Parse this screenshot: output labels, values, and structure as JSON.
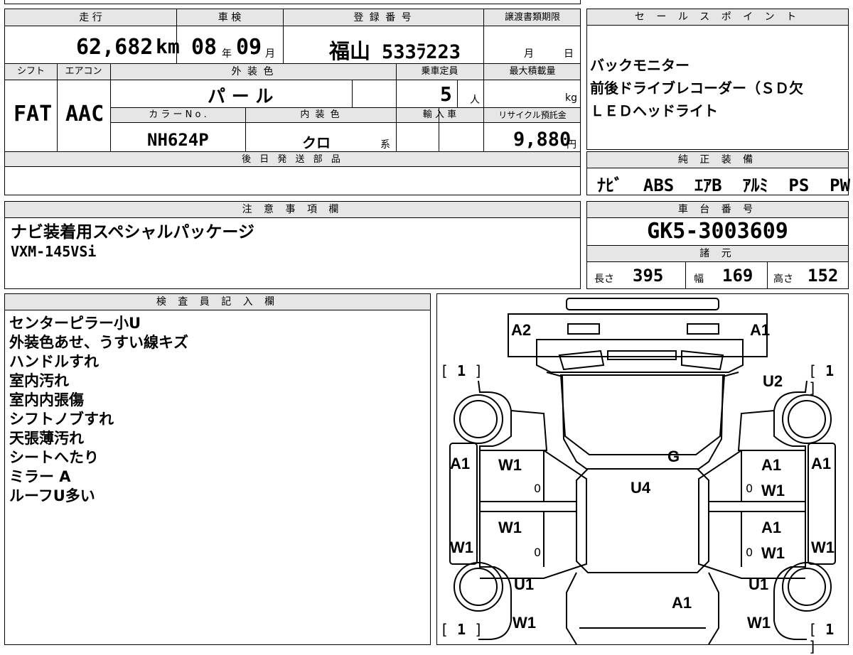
{
  "top": {
    "mileage_label": "走 行",
    "mileage": "62,682",
    "mileage_unit": "km",
    "inspection_label": "車 検",
    "inspection_year": "08",
    "inspection_year_unit": "年",
    "inspection_month": "09",
    "inspection_month_unit": "月",
    "registration_label": "登 録 番 号",
    "registration_place": "福山",
    "registration_number": "533ﾗ223",
    "deadline_label": "譲渡書類期限",
    "deadline_month_unit": "月",
    "deadline_day_unit": "日",
    "shift_label": "シフト",
    "shift": "FAT",
    "aircon_label": "エアコン",
    "aircon": "AAC",
    "exterior_label": "外 装 色",
    "exterior_color": "パ ー ル",
    "capacity_label": "乗車定員",
    "capacity": "5",
    "capacity_unit": "人",
    "maxload_label": "最大積載量",
    "maxload_unit": "kg",
    "colorno_label": "カ ラ ー N o .",
    "colorno": "NH624P",
    "interior_label": "内 装 色",
    "interior_color": "クロ",
    "interior_suffix": "系",
    "import_label": "輸 入 車",
    "recycle_label": "リサイクル預託金",
    "recycle": "9,880",
    "recycle_unit": "円",
    "later_parts_label": "後 日 発 送 部 品"
  },
  "sales": {
    "label": "セ ー ル ス ポ イ ン ト",
    "lines": [
      "バックモニター",
      "前後ドライブレコーダー（ＳＤ欠",
      "ＬＥＤヘッドライト"
    ]
  },
  "equipment": {
    "label": "純 正 装 備",
    "items": "ﾅﾋﾞ  ABS  ｴｱB  ｱﾙﾐ  PS  PW"
  },
  "notes": {
    "label": "注 意 事 項 欄",
    "lines": [
      "ナビ装着用スペシャルパッケージ",
      "VXM-145VSi"
    ]
  },
  "chassis": {
    "label": "車 台 番 号",
    "number": "GK5-3003609"
  },
  "specs": {
    "label": "諸 元",
    "length_label": "長さ",
    "length": "395",
    "width_label": "幅",
    "width": "169",
    "height_label": "高さ",
    "height": "152"
  },
  "inspector": {
    "label": "検 査 員 記 入 欄",
    "lines": [
      "センターピラー小U",
      "外装色あせ、うすい線キズ",
      "ハンドルすれ",
      "室内汚れ",
      "室内内張傷",
      "シフトノブすれ",
      "天張薄汚れ",
      "シートへたり",
      "ミラー A",
      "ルーフU多い"
    ]
  },
  "diagram": {
    "codes": {
      "front_left": "A2",
      "front_right": "A1",
      "tire_fl": "1",
      "tire_fr": "1",
      "fender_fr": "U2",
      "hood": "G",
      "roof": "U4",
      "left_front_door_side": "A1",
      "right_front_door_side": "A1",
      "left_front_door": "W1",
      "right_front_door_a": "A1",
      "right_front_door_w": "W1",
      "left_rear_door": "W1",
      "right_rear_door_a": "A1",
      "right_rear_door_w": "W1",
      "left_rear_side": "W1",
      "right_rear_side": "W1",
      "left_rear_fender": "U1",
      "right_rear_fender": "U1",
      "rear_center": "A1",
      "left_rear_bottom": "W1",
      "right_rear_bottom": "W1",
      "tire_rl": "1",
      "tire_rr": "1",
      "zero": "0"
    }
  }
}
